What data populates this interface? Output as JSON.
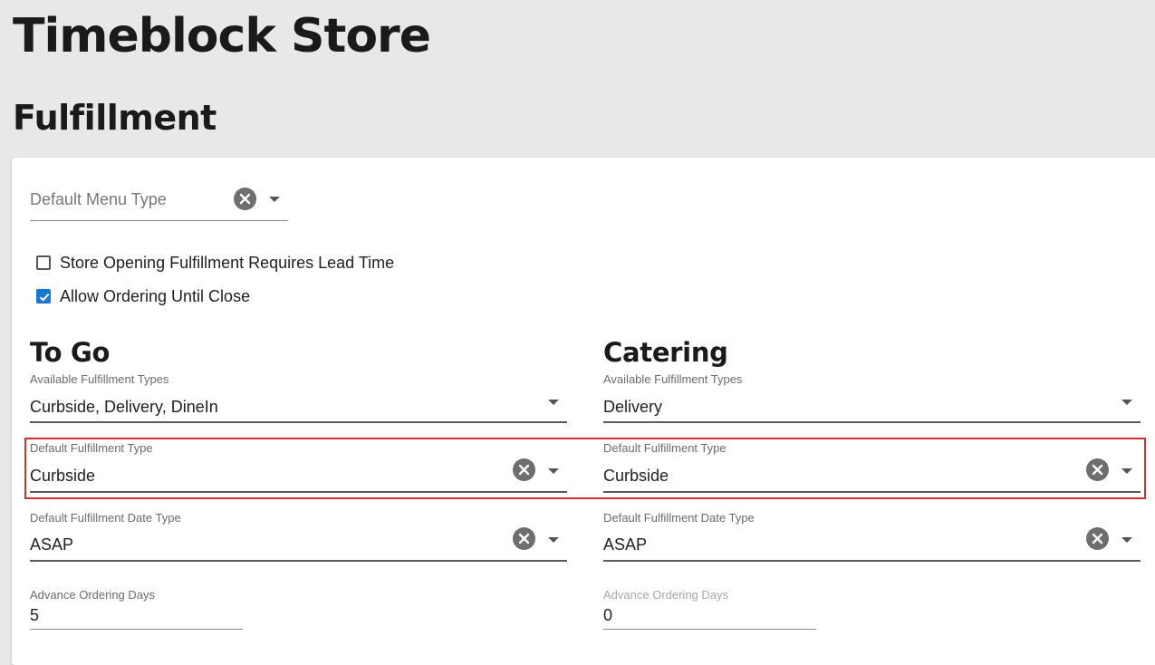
{
  "page": {
    "store_title": "Timeblock Store",
    "section_title": "Fulfillment"
  },
  "default_menu_type": {
    "placeholder": "Default Menu Type"
  },
  "checkboxes": [
    {
      "label": "Store Opening Fulfillment Requires Lead Time",
      "checked": false
    },
    {
      "label": "Allow Ordering Until Close",
      "checked": true
    }
  ],
  "columns": {
    "to_go": {
      "title": "To Go",
      "available_types": {
        "label": "Available Fulfillment Types",
        "value": "Curbside, Delivery, DineIn"
      },
      "default_type": {
        "label": "Default Fulfillment Type",
        "value": "Curbside"
      },
      "date_type": {
        "label": "Default Fulfillment Date Type",
        "value": "ASAP"
      },
      "advance_days": {
        "label": "Advance Ordering Days",
        "value": "5"
      }
    },
    "catering": {
      "title": "Catering",
      "available_types": {
        "label": "Available Fulfillment Types",
        "value": "Delivery"
      },
      "default_type": {
        "label": "Default Fulfillment Type",
        "value": "Curbside"
      },
      "date_type": {
        "label": "Default Fulfillment Date Type",
        "value": "ASAP"
      },
      "advance_days": {
        "label": "Advance Ordering Days",
        "value": "0"
      }
    }
  },
  "colors": {
    "highlight": "#d32f2f",
    "checkbox_checked": "#1976d2",
    "page_bg": "#e8e8e8"
  },
  "icons": {
    "clear": "close-circle-icon",
    "dropdown": "caret-down-icon",
    "check": "checkmark-icon"
  }
}
